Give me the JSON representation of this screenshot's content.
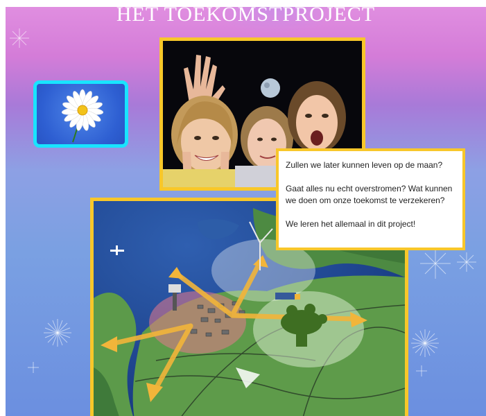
{
  "header": {
    "title": "HET TOEKOMSTPROJECT"
  },
  "thumbnail": {
    "icon": "daisy-flower"
  },
  "photo": {
    "subject": "children-photo"
  },
  "infobox": {
    "q1": "Zullen we later kunnen leven op de maan?",
    "q2": "Gaat alles nu echt overstromen?  Wat kunnen we doen om onze toekomst te verzekeren?",
    "q3": "We leren het allemaal in dit project!"
  },
  "map": {
    "subject": "future-netherlands-map"
  },
  "colors": {
    "frame": "#f8c72a",
    "thumbnail_frame": "#19e4ff"
  }
}
